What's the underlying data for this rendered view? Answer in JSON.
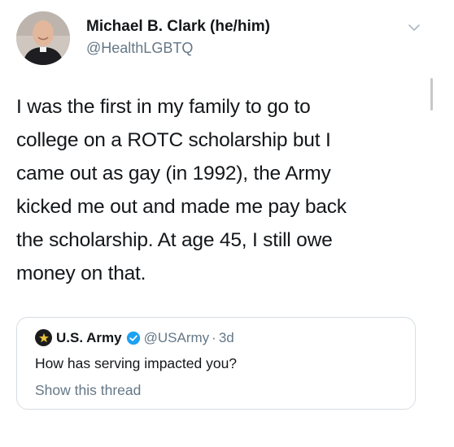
{
  "tweet": {
    "author": {
      "name": "Michael B. Clark (he/him)",
      "handle": "@HealthLGBTQ"
    },
    "caret_icon": "chevron-down-icon",
    "text_lines": [
      "I was the first in my family to go to",
      "college on a ROTC scholarship but I",
      "came out as gay (in 1992), the Army",
      "kicked me out and made me pay back",
      "the scholarship. At age 45, I still owe",
      "money on that."
    ]
  },
  "quoted_tweet": {
    "name": "U.S. Army",
    "verified_icon": "verified-badge-icon",
    "handle": "@USArmy",
    "separator": "·",
    "time": "3d",
    "text": "How has serving impacted you?",
    "show_thread": "Show this thread"
  },
  "colors": {
    "text": "#14171a",
    "secondary": "#657786",
    "verified": "#1da1f2",
    "border": "#d6dde3"
  }
}
